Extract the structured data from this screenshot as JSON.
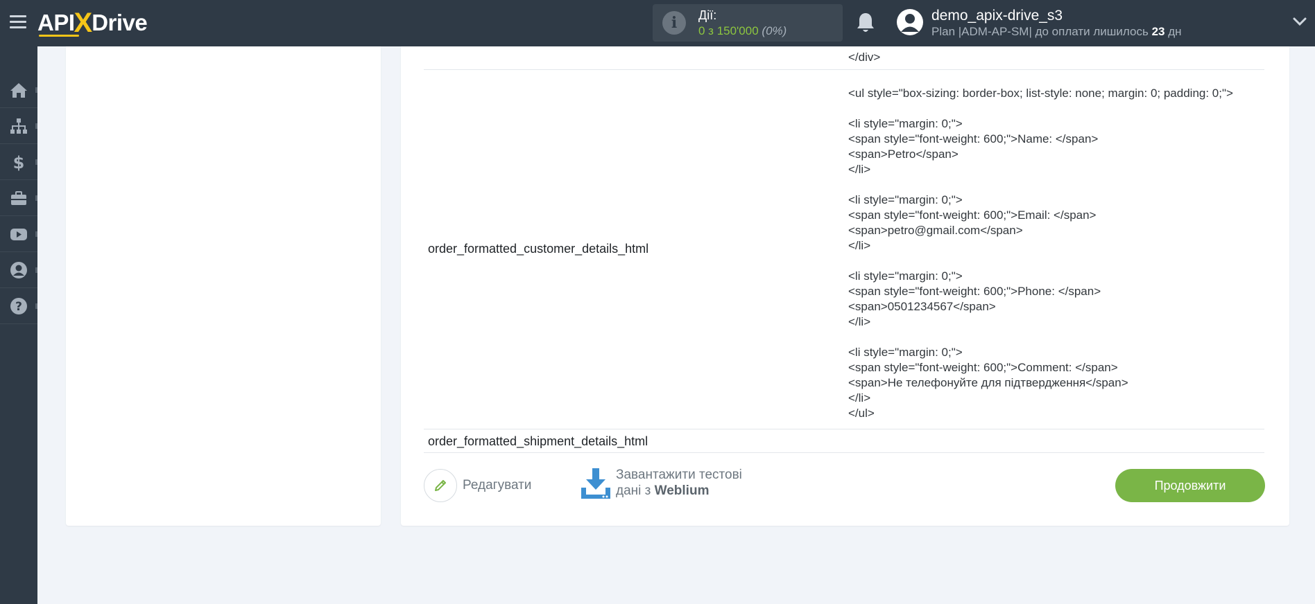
{
  "header": {
    "logo": {
      "part1": "API",
      "x": "X",
      "part2": "Drive"
    },
    "actions": {
      "label": "Дії:",
      "count": "0 з 150'000",
      "percent": "(0%)"
    },
    "user": {
      "name": "demo_apix-drive_s3",
      "plan_prefix": "Plan |ADM-AP-SM| до оплати лишилось",
      "days": "23",
      "days_unit": "дн"
    }
  },
  "sidebar": {
    "items": [
      "home-icon",
      "sitemap-icon",
      "dollar-icon",
      "briefcase-icon",
      "youtube-icon",
      "user-circle-icon",
      "question-icon"
    ]
  },
  "fields": [
    {
      "name": "",
      "value": "</div>"
    },
    {
      "name": "order_formatted_customer_details_html",
      "value": "<ul style=\"box-sizing: border-box; list-style: none; margin: 0; padding: 0;\">\n\n<li style=\"margin: 0;\">\n<span style=\"font-weight: 600;\">Name: </span>\n<span>Petro</span>\n</li>\n\n<li style=\"margin: 0;\">\n<span style=\"font-weight: 600;\">Email: </span>\n<span>petro@gmail.com</span>\n</li>\n\n<li style=\"margin: 0;\">\n<span style=\"font-weight: 600;\">Phone: </span>\n<span>0501234567</span>\n</li>\n\n<li style=\"margin: 0;\">\n<span style=\"font-weight: 600;\">Comment: </span>\n<span>Не телефонуйте для підтвердження</span>\n</li>\n</ul>"
    },
    {
      "name": "order_formatted_shipment_details_html",
      "value": ""
    }
  ],
  "footer": {
    "edit_label": "Редагувати",
    "download_line1": "Завантажити тестові",
    "download_line2_prefix": "дані з",
    "download_source": "Weblium",
    "continue_label": "Продовжити"
  },
  "colors": {
    "topbar": "#2f3a46",
    "accent_green": "#7ab547",
    "logo_yellow": "#f5c518",
    "download_blue": "#3d8fd1"
  }
}
